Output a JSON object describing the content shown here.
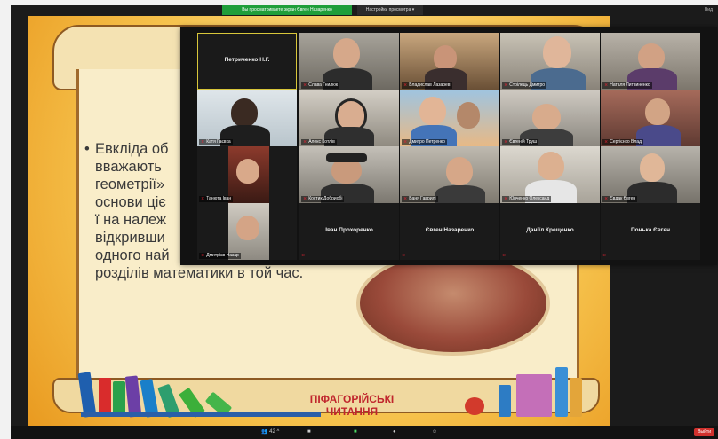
{
  "share_banner": "Вы просматриваете экран Євген Назаренко",
  "view_options_label": "Настройки просмотра",
  "view_options_arrow": "▾",
  "corner_label": "Вид",
  "slide": {
    "bullet": "•",
    "lines": [
      "Евкліда об",
      "вважають",
      "геометрії»",
      "основи цiє",
      "ї на належ",
      "відкривши",
      "одного най",
      "розділів математики в той час."
    ],
    "event_title_line1": "ПІФАГОРІЙСЬКІ",
    "event_title_line2": "ЧИТАННЯ"
  },
  "gallery": {
    "host_name": "Петриченко Н.Г.",
    "tiles": [
      {
        "name": "Слава Гнилюк",
        "muted": true
      },
      {
        "name": "Владислав Лазарев",
        "muted": true
      },
      {
        "name": "Стрілець Дмитро",
        "muted": true
      },
      {
        "name": "Наталя Литвиненко",
        "muted": true
      },
      {
        "name": "Катя Гаєвка",
        "muted": true
      },
      {
        "name": "Алекс Котлів",
        "muted": true
      },
      {
        "name": "Дмитро Петренко",
        "muted": true
      },
      {
        "name": "Євгеній Труш",
        "muted": true
      },
      {
        "name": "Сергієнко Влад",
        "muted": true
      },
      {
        "name": "Танюта Іван",
        "muted": true
      },
      {
        "name": "Костик Добриобі",
        "muted": true
      },
      {
        "name": "Ваня Гаврилі",
        "muted": true
      },
      {
        "name": "Юрченко Олександ",
        "muted": true
      },
      {
        "name": "Євдак Євген",
        "muted": true
      },
      {
        "name": "Дмитрієв Назар",
        "muted": true
      }
    ],
    "name_only_tiles": [
      {
        "name": "Іван Прохоренко"
      },
      {
        "name": "Євген Назаренко"
      },
      {
        "name": "Даніїл Крещенко"
      },
      {
        "name": "Понька Євген"
      }
    ]
  },
  "toolbar": {
    "participants_count": "42",
    "chevron": "^",
    "chat_icon_glyph": "■",
    "share_icon_glyph": "■",
    "record_icon_glyph": "●",
    "reactions_icon_glyph": "☺",
    "end_label": "Выйти"
  },
  "colors": {
    "share_banner": "#1f9e3a",
    "muted_mic": "#e22233",
    "active_speaker_outline": "#d8c63a",
    "event_title": "#c0262d"
  }
}
